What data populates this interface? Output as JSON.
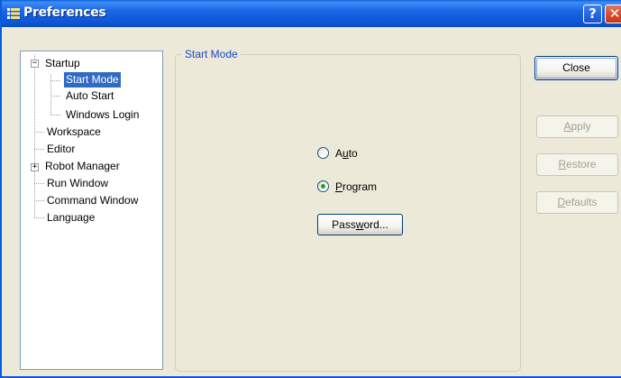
{
  "window": {
    "title": "Preferences",
    "help_label": "?",
    "close_label": "✕"
  },
  "tree": {
    "items": [
      {
        "label": "Startup",
        "expander": "−"
      },
      {
        "label": "Start Mode"
      },
      {
        "label": "Auto Start"
      },
      {
        "label": "Windows Login"
      },
      {
        "label": "Workspace"
      },
      {
        "label": "Editor"
      },
      {
        "label": "Robot Manager",
        "expander": "+"
      },
      {
        "label": "Run Window"
      },
      {
        "label": "Command Window"
      },
      {
        "label": "Language"
      }
    ],
    "selected": "Start Mode"
  },
  "start_mode": {
    "group_title": "Start Mode",
    "options": [
      {
        "pre": "A",
        "mnemonic": "u",
        "post": "to",
        "selected": false
      },
      {
        "pre": "",
        "mnemonic": "P",
        "post": "rogram",
        "selected": true
      }
    ],
    "password_button": {
      "pre": "Pass",
      "mnemonic": "w",
      "post": "ord..."
    }
  },
  "buttons": {
    "close": {
      "label": "Close",
      "enabled": true
    },
    "apply": {
      "mnemonic": "A",
      "post": "pply",
      "enabled": false
    },
    "restore": {
      "mnemonic": "R",
      "post": "estore",
      "enabled": false
    },
    "defaults": {
      "mnemonic": "D",
      "post": "efaults",
      "enabled": false
    }
  },
  "colors": {
    "titlebar": "#0a5fd7",
    "dialog_bg": "#ece9d8",
    "selection": "#316ac5",
    "group_title": "#1a48c8",
    "radio_dot": "#21a121",
    "close_button": "#d5492a"
  }
}
